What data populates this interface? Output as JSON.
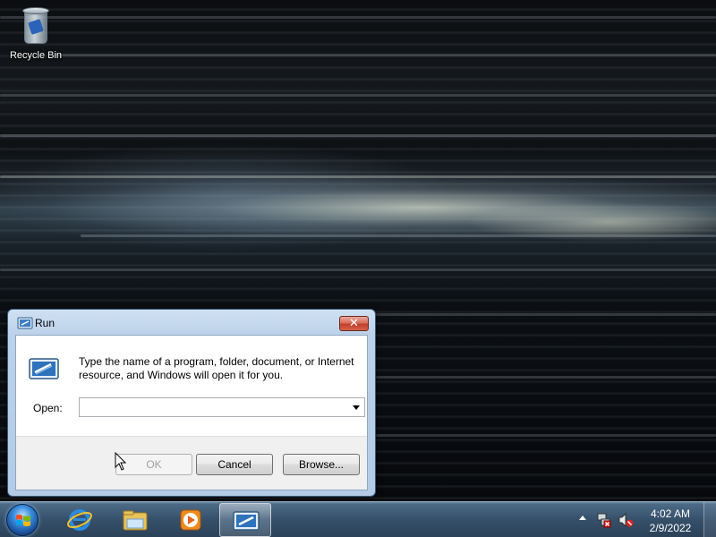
{
  "desktop": {
    "icons": [
      {
        "label": "Recycle Bin",
        "icon": "recycle-bin-icon"
      }
    ]
  },
  "run_dialog": {
    "title": "Run",
    "description": "Type the name of a program, folder, document, or Internet resource, and Windows will open it for you.",
    "open_label": "Open:",
    "open_value": "",
    "buttons": {
      "ok": "OK",
      "cancel": "Cancel",
      "browse": "Browse..."
    },
    "ok_enabled": false
  },
  "taskbar": {
    "start": "start-orb-windows-icon",
    "pinned": [
      {
        "icon": "internet-explorer-icon"
      },
      {
        "icon": "windows-explorer-icon"
      },
      {
        "icon": "media-player-icon"
      },
      {
        "icon": "run-icon",
        "active": true
      }
    ],
    "tray": {
      "icons": [
        "show-hidden-icons-icon",
        "network-disconnected-icon",
        "volume-muted-icon"
      ],
      "time": "4:02 AM",
      "date": "2/9/2022"
    }
  },
  "colors": {
    "taskbar": "#36506a",
    "dialog_frame": "#b4cbe5",
    "close_button": "#c2402a"
  }
}
